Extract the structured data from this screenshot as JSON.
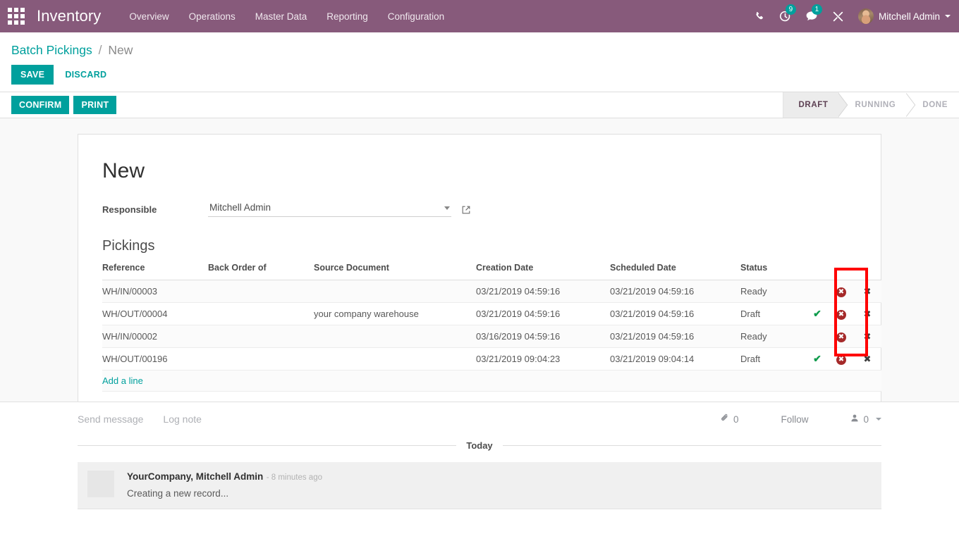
{
  "navbar": {
    "apps_icon": "apps-grid-icon",
    "brand": "Inventory",
    "menu": [
      {
        "label": "Overview"
      },
      {
        "label": "Operations"
      },
      {
        "label": "Master Data"
      },
      {
        "label": "Reporting"
      },
      {
        "label": "Configuration"
      }
    ],
    "icons": {
      "phone": "phone-icon",
      "activity": "clock-activity-icon",
      "messages": "chat-bubble-icon",
      "debug": "wrench-tools-icon"
    },
    "activity_count": "9",
    "message_count": "1",
    "user_name": "Mitchell Admin"
  },
  "breadcrumb": {
    "root": "Batch Pickings",
    "separator": "/",
    "current": "New"
  },
  "edit_actions": {
    "save_label": "SAVE",
    "discard_label": "DISCARD"
  },
  "action_bar": {
    "confirm_label": "CONFIRM",
    "print_label": "PRINT",
    "statusbar": [
      {
        "label": "DRAFT",
        "active": true
      },
      {
        "label": "RUNNING",
        "active": false
      },
      {
        "label": "DONE",
        "active": false
      }
    ]
  },
  "form": {
    "record_title": "New",
    "responsible": {
      "label": "Responsible",
      "value": "Mitchell Admin",
      "placeholder": ""
    },
    "pickings": {
      "title": "Pickings",
      "columns": [
        "Reference",
        "Back Order of",
        "Source Document",
        "Creation Date",
        "Scheduled Date",
        "Status"
      ],
      "rows": [
        {
          "reference": "WH/IN/00003",
          "back_order_of": "",
          "source_document": "",
          "creation_date": "03/21/2019 04:59:16",
          "scheduled_date": "03/21/2019 04:59:16",
          "status": "Ready",
          "check": "",
          "cancel": "✖",
          "delete": "✖"
        },
        {
          "reference": "WH/OUT/00004",
          "back_order_of": "",
          "source_document": "your company warehouse",
          "creation_date": "03/21/2019 04:59:16",
          "scheduled_date": "03/21/2019 04:59:16",
          "status": "Draft",
          "check": "✔",
          "cancel": "✖",
          "delete": "✖"
        },
        {
          "reference": "WH/IN/00002",
          "back_order_of": "",
          "source_document": "",
          "creation_date": "03/16/2019 04:59:16",
          "scheduled_date": "03/21/2019 04:59:16",
          "status": "Ready",
          "check": "",
          "cancel": "✖",
          "delete": "✖"
        },
        {
          "reference": "WH/OUT/00196",
          "back_order_of": "",
          "source_document": "",
          "creation_date": "03/21/2019 09:04:23",
          "scheduled_date": "03/21/2019 09:04:14",
          "status": "Draft",
          "check": "✔",
          "cancel": "✖",
          "delete": "✖"
        }
      ],
      "add_line_label": "Add a line"
    }
  },
  "chatter": {
    "send_message_label": "Send message",
    "log_note_label": "Log note",
    "attachment_count": "0",
    "follow_label": "Follow",
    "follower_count": "0",
    "day_divider": "Today",
    "messages": [
      {
        "author": "YourCompany, Mitchell Admin",
        "time": "- 8 minutes ago",
        "body": "Creating a new record..."
      }
    ]
  },
  "colors": {
    "brand_purple": "#875A7B",
    "accent_teal": "#00A09D",
    "annotation_red": "#ff0000",
    "status_ok_green": "#0f9b4c",
    "cancel_red": "#a52a2a"
  }
}
